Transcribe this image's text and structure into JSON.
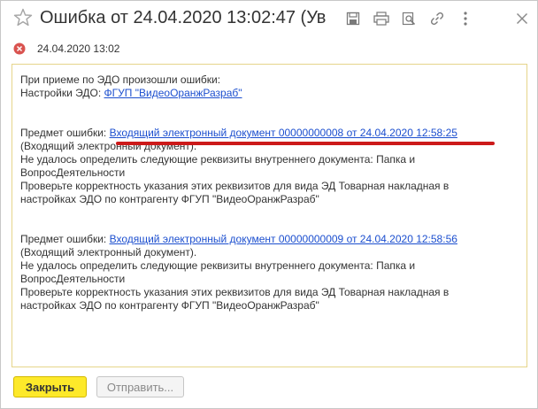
{
  "window": {
    "title": "Ошибка от 24.04.2020 13:02:47 (Ув"
  },
  "header": {
    "date": "24.04.2020 13:02"
  },
  "toolbar": {
    "icons": [
      "star-icon",
      "save-icon",
      "print-icon",
      "preview-icon",
      "link-icon",
      "more-icon",
      "close-icon"
    ]
  },
  "message": {
    "intro_line1": "При приеме по ЭДО произошли ошибки:",
    "settings_label": "Настройки ЭДО:",
    "settings_link": "ФГУП \"ВидеоОранжРазраб\"",
    "errors": [
      {
        "subject_label": "Предмет ошибки:",
        "subject_link": "Входящий электронный документ 00000000008 от 24.04.2020 12:58:25",
        "line1": "(Входящий электронный документ).",
        "line2": "Не удалось определить следующие реквизиты внутреннего документа: Папка и",
        "line3": "ВопросДеятельности",
        "line4": "Проверьте корректность указания этих реквизитов для вида ЭД Товарная накладная в",
        "line5": "настройках ЭДО по контрагенту ФГУП \"ВидеоОранжРазраб\""
      },
      {
        "subject_label": "Предмет ошибки:",
        "subject_link": "Входящий электронный документ 00000000009 от 24.04.2020 12:58:56",
        "line1": "(Входящий электронный документ).",
        "line2": "Не удалось определить следующие реквизиты внутреннего документа: Папка и",
        "line3": "ВопросДеятельности",
        "line4": "Проверьте корректность указания этих реквизитов для вида ЭД Товарная накладная в",
        "line5": "настройках ЭДО по контрагенту ФГУП \"ВидеоОранжРазраб\""
      }
    ]
  },
  "buttons": {
    "close_label": "Закрыть",
    "send_label": "Отправить..."
  },
  "colors": {
    "primary_button": "#fde92a",
    "link": "#1c4fcf",
    "error_icon": "#d9534f",
    "highlight_underline": "#cc1a1a",
    "message_border": "#e6d58a"
  }
}
